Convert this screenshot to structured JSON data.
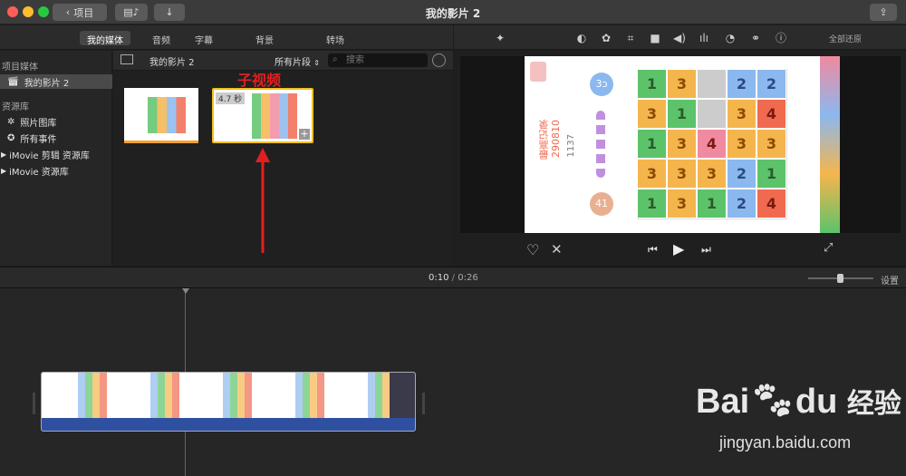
{
  "window": {
    "title": "我的影片 2",
    "back_label": "项目"
  },
  "tabs": [
    {
      "label": "我的媒体",
      "active": true
    },
    {
      "label": "音频",
      "active": false
    },
    {
      "label": "字幕",
      "active": false
    },
    {
      "label": "背景",
      "active": false
    },
    {
      "label": "转场",
      "active": false
    }
  ],
  "tools": [
    "magic-wand-icon",
    "color-balance-icon",
    "color-correction-icon",
    "crop-icon",
    "stabilization-icon",
    "volume-icon",
    "equalizer-icon",
    "speed-icon",
    "filter-icon",
    "info-icon"
  ],
  "reset_all": "全部还原",
  "sidebar": {
    "project_heading": "项目媒体",
    "project_item": "我的影片 2",
    "library_heading": "资源库",
    "library_items": [
      "照片图库",
      "所有事件",
      "iMovie 剪辑 资源库",
      "iMovie 资源库"
    ]
  },
  "browser": {
    "title": "我的影片 2",
    "filter_label": "所有片段",
    "search_placeholder": "搜索",
    "clip_duration": "4.7 秒",
    "annotation_label": "子视频"
  },
  "viewer": {
    "record_label": "最高记录",
    "record_value": "290810",
    "score_value": "1137",
    "badge_top": "3ɔ",
    "badge_bottom": "41",
    "grid": [
      [
        {
          "v": "1",
          "c": "green"
        },
        {
          "v": "3",
          "c": "orange"
        },
        {
          "v": "",
          "c": "gray"
        },
        {
          "v": "2",
          "c": "blue"
        },
        {
          "v": "2",
          "c": "blue"
        }
      ],
      [
        {
          "v": "3",
          "c": "orange"
        },
        {
          "v": "1",
          "c": "green"
        },
        {
          "v": "",
          "c": "gray"
        },
        {
          "v": "3",
          "c": "orange"
        },
        {
          "v": "4",
          "c": "red"
        }
      ],
      [
        {
          "v": "1",
          "c": "green"
        },
        {
          "v": "3",
          "c": "orange"
        },
        {
          "v": "4",
          "c": "pink"
        },
        {
          "v": "3",
          "c": "orange"
        },
        {
          "v": "3",
          "c": "orange"
        }
      ],
      [
        {
          "v": "3",
          "c": "orange"
        },
        {
          "v": "3",
          "c": "orange"
        },
        {
          "v": "3",
          "c": "orange"
        },
        {
          "v": "2",
          "c": "blue"
        },
        {
          "v": "1",
          "c": "green"
        }
      ],
      [
        {
          "v": "1",
          "c": "green"
        },
        {
          "v": "3",
          "c": "orange"
        },
        {
          "v": "1",
          "c": "green"
        },
        {
          "v": "2",
          "c": "blue"
        },
        {
          "v": "4",
          "c": "red"
        }
      ]
    ]
  },
  "timecode": {
    "current": "0:10",
    "separator": "/",
    "total": "0:26"
  },
  "settings_label": "设置",
  "watermark": {
    "brand": "Bai",
    "brand2": "du",
    "sub": "经验",
    "url": "jingyan.baidu.com"
  },
  "colors": {
    "green": "#5cc36a",
    "orange": "#f5b54d",
    "blue": "#8bb8ee",
    "red": "#f06a50",
    "pink": "#f08aa0",
    "gray": "#cccccc",
    "accent": "#f0c020"
  }
}
